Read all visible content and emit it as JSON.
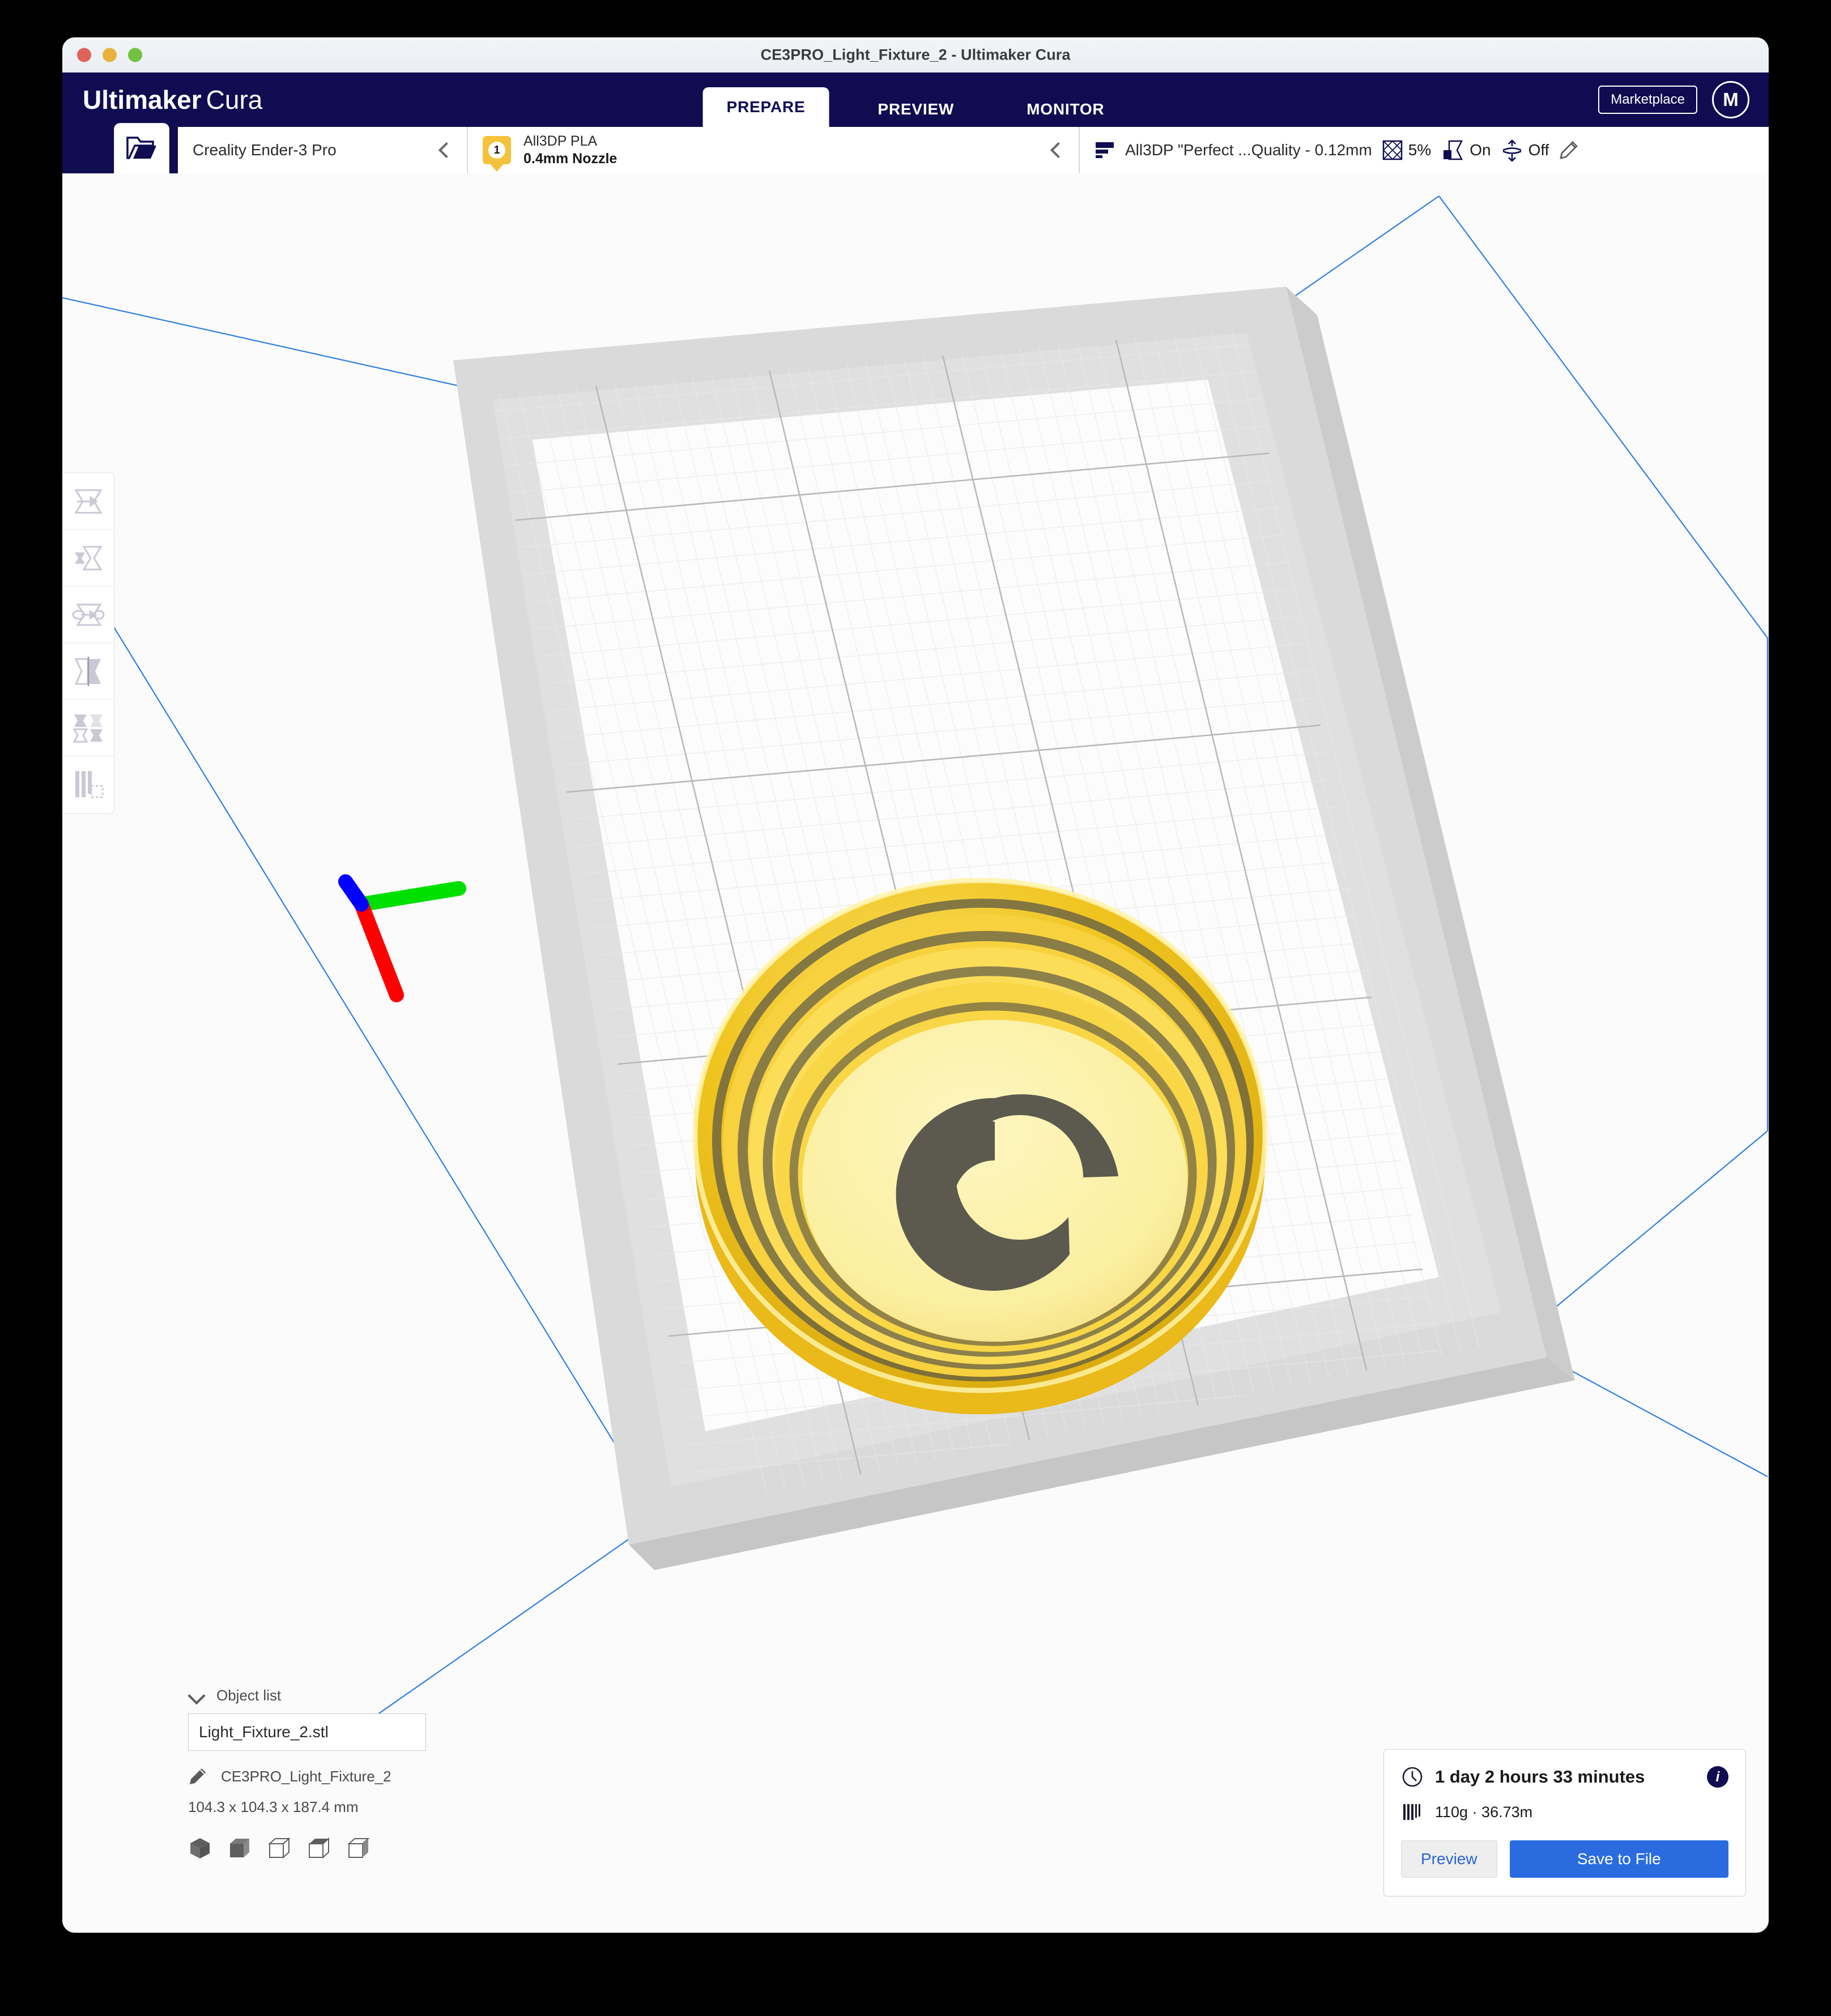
{
  "window": {
    "title": "CE3PRO_Light_Fixture_2 - Ultimaker Cura",
    "traffic_lights": [
      "close",
      "minimize",
      "maximize"
    ]
  },
  "header": {
    "brand_bold": "Ultimaker",
    "brand_light": "Cura",
    "tabs": [
      {
        "label": "PREPARE",
        "active": true
      },
      {
        "label": "PREVIEW",
        "active": false
      },
      {
        "label": "MONITOR",
        "active": false
      }
    ],
    "marketplace_label": "Marketplace",
    "avatar_initial": "M"
  },
  "config_bar": {
    "open_file_icon": "open-folder-icon",
    "printer": {
      "name": "Creality Ender-3 Pro",
      "chevron": "chevron-left-icon"
    },
    "material": {
      "extruder_number": "1",
      "name": "All3DP PLA",
      "nozzle": "0.4mm Nozzle",
      "chevron": "chevron-left-icon"
    },
    "profile": {
      "layer_icon": "layer-height-icon",
      "name": "All3DP \"Perfect ...Quality - 0.12mm",
      "infill_icon": "infill-icon",
      "infill_value": "5%",
      "support_icon": "support-icon",
      "support_value": "On",
      "adhesion_icon": "adhesion-icon",
      "adhesion_value": "Off",
      "edit_icon": "pencil-icon"
    }
  },
  "tools": [
    {
      "name": "move-tool",
      "icon": "move-icon"
    },
    {
      "name": "scale-tool",
      "icon": "scale-icon"
    },
    {
      "name": "rotate-tool",
      "icon": "rotate-icon"
    },
    {
      "name": "mirror-tool",
      "icon": "mirror-icon"
    },
    {
      "name": "per-model-settings-tool",
      "icon": "per-model-settings-icon"
    },
    {
      "name": "support-blocker-tool",
      "icon": "support-blocker-icon"
    }
  ],
  "object_list": {
    "title": "Object list",
    "collapse_icon": "chevron-down-icon",
    "items": [
      {
        "label": "Light_Fixture_2.stl"
      }
    ],
    "model_edit_icon": "pencil-icon",
    "model_name": "CE3PRO_Light_Fixture_2",
    "dimensions": "104.3 x 104.3 x 187.4 mm",
    "view_buttons": [
      "view-3d-icon",
      "view-front-icon",
      "view-top-icon",
      "view-left-icon",
      "view-right-icon"
    ]
  },
  "print_info": {
    "time_icon": "clock-icon",
    "time": "1 day 2 hours 33 minutes",
    "info_badge": "info-icon",
    "material_icon": "filament-icon",
    "material": "110g · 36.73m",
    "preview_label": "Preview",
    "save_label": "Save to File"
  },
  "scene": {
    "model_name": "Light_Fixture_2",
    "model_color": "#f2c61e",
    "model_top_color": "#faf0a0",
    "build_plate_color": "#d4d4d4",
    "grid_color": "#c8c8c8",
    "boundary_color": "#2f7fe0",
    "axis_x_color": "#ff0000",
    "axis_y_color": "#00e000",
    "axis_z_color": "#0000ff",
    "background_color": "#fbfbfb"
  }
}
